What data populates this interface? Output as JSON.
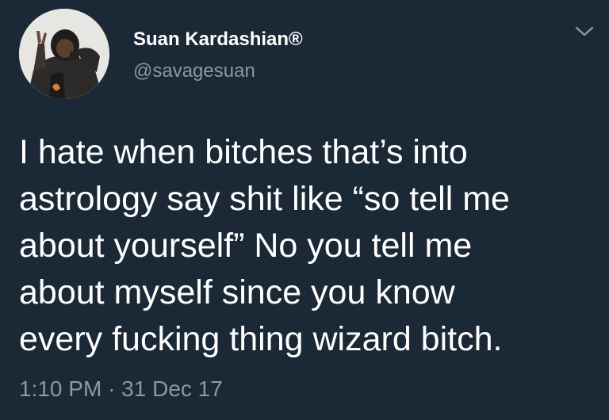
{
  "author": {
    "display_name": "Suan Kardashian®",
    "handle": "@savagesuan",
    "avatar_icon": "profile-photo"
  },
  "tweet": {
    "lines": [
      "I hate when bitches that’s into",
      "astrology say shit like “so tell me",
      "about yourself” No you tell me",
      "about myself since you know",
      "every fucking thing wizard bitch."
    ],
    "time": "1:10 PM",
    "separator": "·",
    "date": "31 Dec 17"
  },
  "menu": {
    "icon": "chevron-down-icon"
  },
  "colors": {
    "background": "#1b2836",
    "primary_text": "#ffffff",
    "secondary_text": "#8899a6"
  }
}
